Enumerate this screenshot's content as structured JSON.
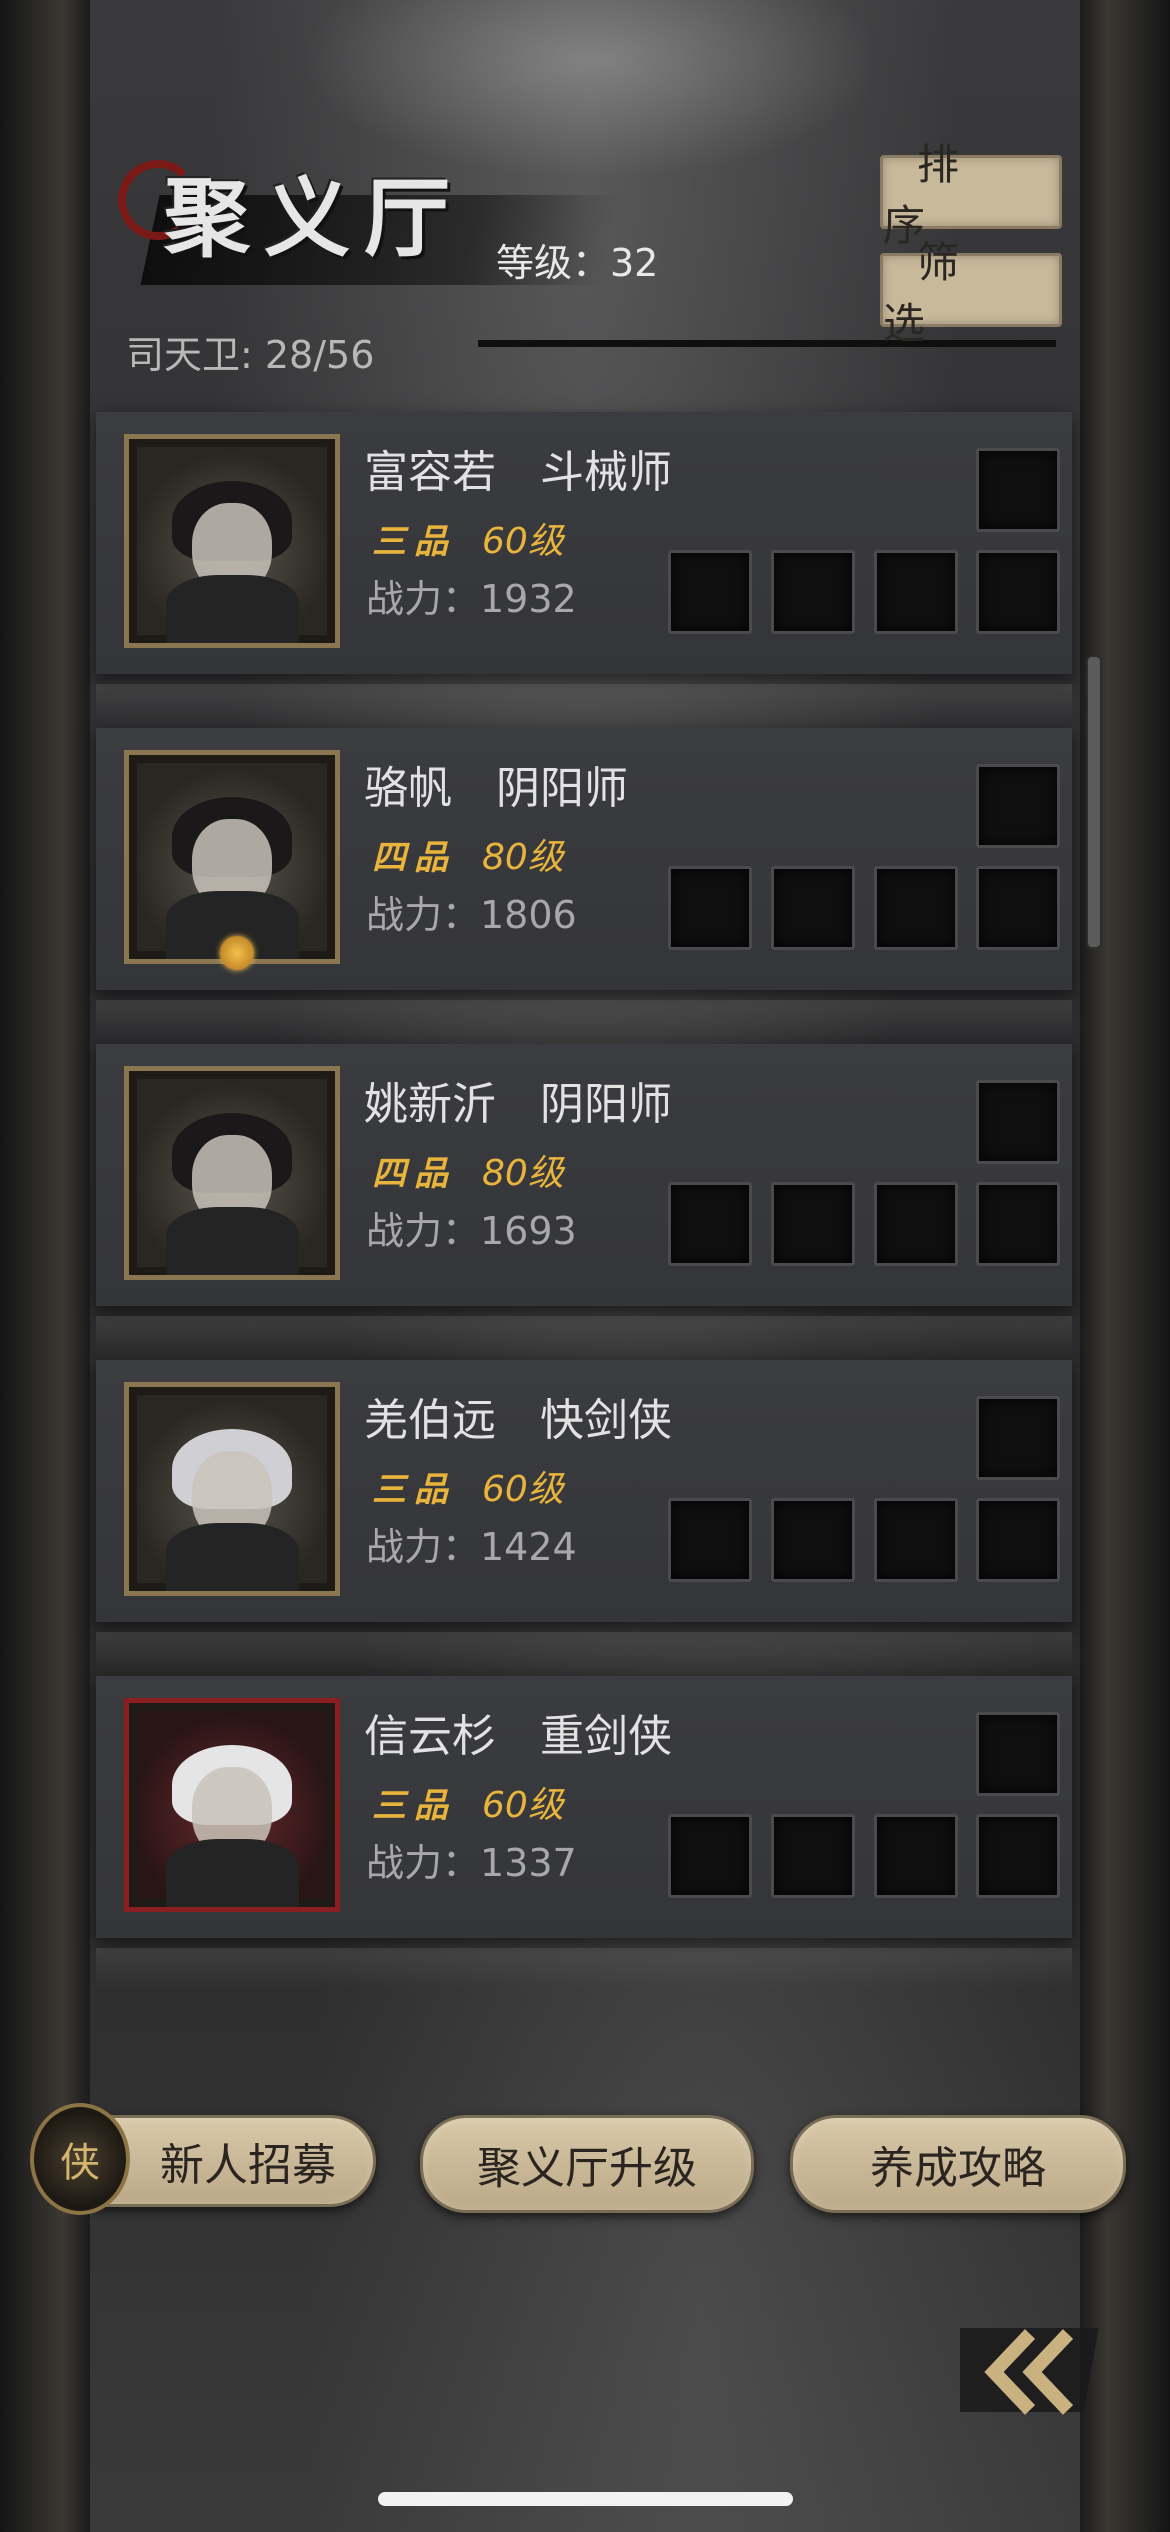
{
  "header": {
    "title": "聚义厅",
    "level_label": "等级：32",
    "guard_label": "司天卫: 28/56",
    "sort_label": "排序",
    "filter_label": "筛选"
  },
  "members": [
    {
      "name": "富容若",
      "class": "斗械师",
      "grade": "三品",
      "level": "60级",
      "power": "战力：1932",
      "frame": "gold"
    },
    {
      "name": "骆帆",
      "class": "阴阳师",
      "grade": "四品",
      "level": "80级",
      "power": "战力：1806",
      "frame": "gold"
    },
    {
      "name": "姚新沂",
      "class": "阴阳师",
      "grade": "四品",
      "level": "80级",
      "power": "战力：1693",
      "frame": "gold"
    },
    {
      "name": "羌伯远",
      "class": "快剑侠",
      "grade": "三品",
      "level": "60级",
      "power": "战力：1424",
      "frame": "gold"
    },
    {
      "name": "信云杉",
      "class": "重剑侠",
      "grade": "三品",
      "level": "60级",
      "power": "战力：1337",
      "frame": "red"
    }
  ],
  "bottom": {
    "recruit_label": "新人招募",
    "upgrade_label": "聚义厅升级",
    "guide_label": "养成攻略",
    "recruit_icon_char": "侠"
  },
  "colors": {
    "gold": "#e9b43c",
    "button_bg": "#c9b99b",
    "red_frame": "#8a1f22"
  }
}
